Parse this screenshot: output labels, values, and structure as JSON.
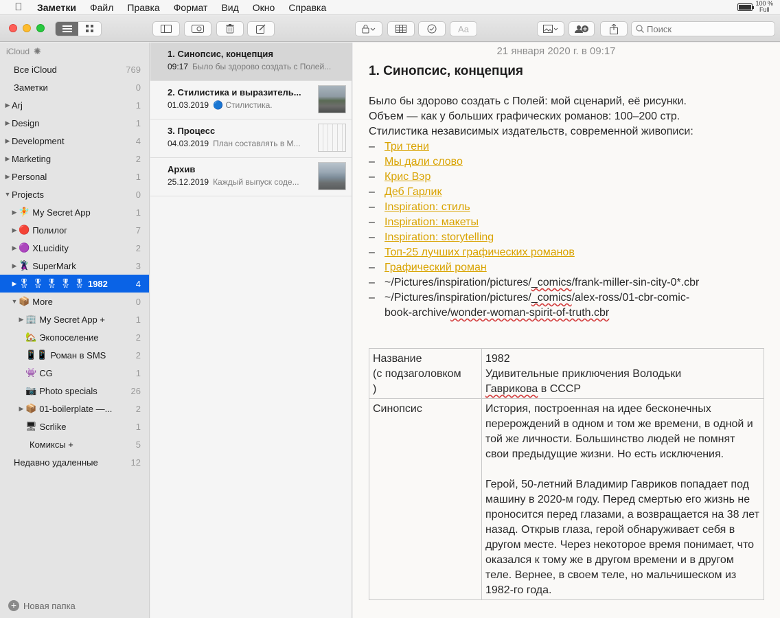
{
  "menubar": {
    "app": "Заметки",
    "items": [
      "Файл",
      "Правка",
      "Формат",
      "Вид",
      "Окно",
      "Справка"
    ],
    "battery_percent": "100 %",
    "battery_state": "Full",
    "battery_level": 1.0
  },
  "toolbar": {
    "search_placeholder": "Поиск",
    "format_label": "Aa"
  },
  "sidebar": {
    "header": "iCloud",
    "items": [
      {
        "label": "Все iCloud",
        "count": "769",
        "indent": 0,
        "arrow": "",
        "emoji": ""
      },
      {
        "label": "Заметки",
        "count": "0",
        "indent": 0,
        "arrow": "",
        "emoji": ""
      },
      {
        "label": "Arj",
        "count": "1",
        "indent": 0,
        "arrow": "▶",
        "emoji": ""
      },
      {
        "label": "Design",
        "count": "1",
        "indent": 0,
        "arrow": "▶",
        "emoji": ""
      },
      {
        "label": "Development",
        "count": "4",
        "indent": 0,
        "arrow": "▶",
        "emoji": ""
      },
      {
        "label": "Marketing",
        "count": "2",
        "indent": 0,
        "arrow": "▶",
        "emoji": ""
      },
      {
        "label": "Personal",
        "count": "1",
        "indent": 0,
        "arrow": "▶",
        "emoji": ""
      },
      {
        "label": "Projects",
        "count": "0",
        "indent": 0,
        "arrow": "▼",
        "emoji": ""
      },
      {
        "label": "My Secret App",
        "count": "1",
        "indent": 1,
        "arrow": "▶",
        "emoji": "🧚"
      },
      {
        "label": "Полилог",
        "count": "7",
        "indent": 1,
        "arrow": "▶",
        "emoji": "🔴"
      },
      {
        "label": "XLucidity",
        "count": "2",
        "indent": 1,
        "arrow": "▶",
        "emoji": "🟣"
      },
      {
        "label": "SuperMark",
        "count": "3",
        "indent": 1,
        "arrow": "▶",
        "emoji": "🦹"
      },
      {
        "label": "1982",
        "count": "4",
        "indent": 1,
        "arrow": "▶",
        "emoji": "🎖 🎖 🎖 🎖 🎖",
        "selected": true
      },
      {
        "label": "More",
        "count": "0",
        "indent": 1,
        "arrow": "▼",
        "emoji": "📦"
      },
      {
        "label": "My Secret App +",
        "count": "1",
        "indent": 2,
        "arrow": "▶",
        "emoji": "🏢"
      },
      {
        "label": "Экопоселение",
        "count": "2",
        "indent": 2,
        "arrow": "",
        "emoji": "🏡"
      },
      {
        "label": "Роман в SMS",
        "count": "2",
        "indent": 2,
        "arrow": "",
        "emoji": "📱📱"
      },
      {
        "label": "CG",
        "count": "1",
        "indent": 2,
        "arrow": "",
        "emoji": "👾"
      },
      {
        "label": "Photo specials",
        "count": "26",
        "indent": 2,
        "arrow": "",
        "emoji": "📷"
      },
      {
        "label": "01-boilerplate —...",
        "count": "2",
        "indent": 2,
        "arrow": "▶",
        "emoji": "📦"
      },
      {
        "label": "Scrlike",
        "count": "1",
        "indent": 2,
        "arrow": "",
        "emoji": "🖥"
      },
      {
        "label": "Комиксы +",
        "count": "5",
        "indent": 2,
        "arrow": "",
        "emoji": ""
      },
      {
        "label": "Недавно удаленные",
        "count": "12",
        "indent": 0,
        "arrow": "",
        "emoji": ""
      }
    ],
    "new_folder": "Новая папка"
  },
  "notes": [
    {
      "title": "1. Синопсис, концепция",
      "date": "09:17",
      "preview": "Было бы здорово создать с Полей...",
      "thumb": ""
    },
    {
      "title": "2. Стилистика и выразитель...",
      "date": "01.03.2019",
      "preview": "🔵 Стилистика.",
      "thumb": "street"
    },
    {
      "title": "3. Процесс",
      "date": "04.03.2019",
      "preview": "План составлять в М...",
      "thumb": "sketch"
    },
    {
      "title": "Архив",
      "date": "25.12.2019",
      "preview": "Каждый выпуск соде...",
      "thumb": "building"
    }
  ],
  "editor": {
    "timestamp": "21 января 2020 г. в 09:17",
    "title": "1. Синопсис, концепция",
    "intro": [
      "Было бы здорово создать с Полей: мой сценарий, её рисунки.",
      "Объем — как у больших графических романов: 100–200 стр.",
      "Стилистика независимых издательств, современной живописи:"
    ],
    "links": [
      "Три тени",
      "Мы дали слово",
      "Крис Вэр",
      "Деб Гарлик",
      "Inspiration: стиль",
      "Inspiration: макеты",
      "Inspiration:  storytelling",
      "Топ-25 лучших графических романов",
      "Графический роман"
    ],
    "paths": [
      [
        "~/Pictures/inspiration/pictures/",
        "_comics",
        "/frank-miller-sin-city-0*.cbr"
      ],
      [
        "~/Pictures/inspiration/pictures/",
        "_comics",
        "/alex-ross/01-cbr-comic-"
      ]
    ],
    "path_continuation": [
      "book-archive/",
      "wonder-woman-spirit-of-truth.cbr"
    ],
    "table": {
      "row1_key": "Название\n(с подзаголовком\n)",
      "row1_value_title": "1982",
      "row1_value_sub_a": "Удивительные приключения Володьки",
      "row1_value_sub_b": "Гаврикова",
      "row1_value_sub_c": " в СССР",
      "row2_key": "Синопсис",
      "row2_p1": "История, построенная на идее бесконечных перерождений в одном и том же времени, в одной и той же личности. Большинство людей не помнят свои предыдущие жизни. Но есть исключения.",
      "row2_p2": "Герой, 50-летний Владимир Гавриков попадает под машину в 2020-м году. Перед смертью его жизнь не проносится перед глазами, а возвращается на 38 лет назад. Открыв глаза, герой обнаруживает себя в другом месте. Через некоторое время понимает, что оказался к тому же в другом времени и в другом теле. Вернее, в своем теле, но мальчишеском из 1982-го года."
    }
  }
}
